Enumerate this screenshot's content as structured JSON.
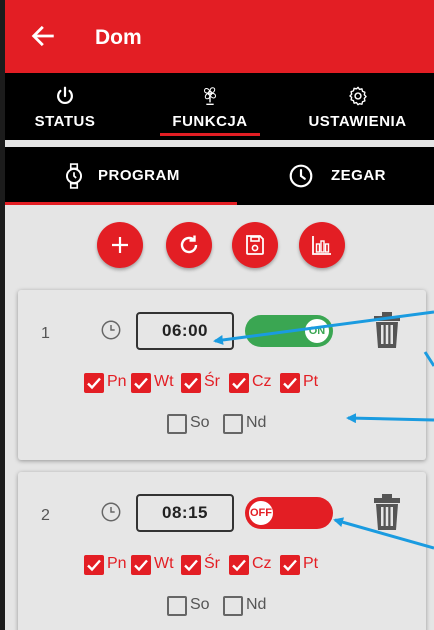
{
  "appbar": {
    "title": "Dom",
    "back_icon": "arrow-left-icon"
  },
  "top_tabs": [
    {
      "label": "STATUS",
      "icon": "power-icon"
    },
    {
      "label": "FUNKCJA",
      "icon": "fan-icon"
    },
    {
      "label": "USTAWIENIA",
      "icon": "gear-icon"
    }
  ],
  "top_tabs_active": "FUNKCJA",
  "sub_tabs": [
    {
      "label": "PROGRAM",
      "icon": "timer-icon"
    },
    {
      "label": "ZEGAR",
      "icon": "clock-icon"
    }
  ],
  "sub_tabs_active": "PROGRAM",
  "actions": [
    {
      "icon": "plus-icon"
    },
    {
      "icon": "refresh-icon"
    },
    {
      "icon": "save-icon"
    },
    {
      "icon": "bar-chart-icon"
    }
  ],
  "programs": [
    {
      "number": "1",
      "time": "06:00",
      "state": "ON",
      "days": [
        {
          "label": "Pn",
          "checked": true
        },
        {
          "label": "Wt",
          "checked": true
        },
        {
          "label": "Śr",
          "checked": true
        },
        {
          "label": "Cz",
          "checked": true
        },
        {
          "label": "Pt",
          "checked": true
        },
        {
          "label": "So",
          "checked": false
        },
        {
          "label": "Nd",
          "checked": false
        }
      ]
    },
    {
      "number": "2",
      "time": "08:15",
      "state": "OFF",
      "days": [
        {
          "label": "Pn",
          "checked": true
        },
        {
          "label": "Wt",
          "checked": true
        },
        {
          "label": "Śr",
          "checked": true
        },
        {
          "label": "Cz",
          "checked": true
        },
        {
          "label": "Pt",
          "checked": true
        },
        {
          "label": "So",
          "checked": false
        },
        {
          "label": "Nd",
          "checked": false
        }
      ]
    }
  ],
  "colors": {
    "primary": "#e31e24",
    "on": "#3aa652",
    "annotation": "#1a9be0"
  }
}
